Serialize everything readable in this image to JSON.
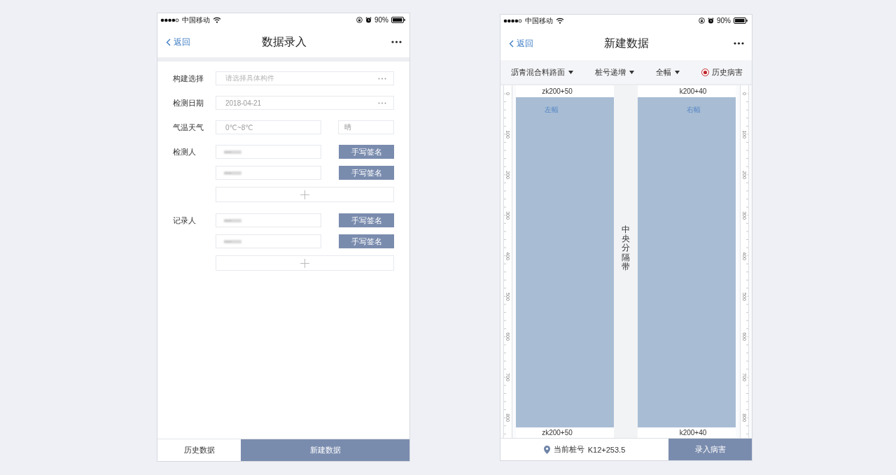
{
  "data_entry_screen": {
    "status_bar": {
      "carrier": "中国移动",
      "battery": "90%"
    },
    "nav_bar": {
      "back": "返回",
      "title": "数据录入"
    },
    "form": {
      "component": {
        "label": "构建选择",
        "placeholder": "请选择具体构件"
      },
      "inspection_date": {
        "label": "检测日期",
        "value": "2018-04-21"
      },
      "weather": {
        "label": "气温天气",
        "temperature": "0℃~8℃",
        "condition": "晴"
      },
      "people_groups": [
        {
          "label": "检测人",
          "entries": [
            {
              "redacted": true,
              "button": "手写签名"
            },
            {
              "redacted": true,
              "button": "手写签名"
            }
          ]
        },
        {
          "label": "记录人",
          "entries": [
            {
              "redacted": true,
              "button": "手写签名"
            },
            {
              "redacted": true,
              "button": "手写签名"
            }
          ]
        }
      ]
    },
    "bottom_actions": [
      {
        "label": "历史数据",
        "kind": "secondary"
      },
      {
        "label": "新建数据",
        "kind": "primary"
      }
    ]
  },
  "new_data_screen": {
    "status_bar": {
      "carrier": "中国移动",
      "battery": "90%"
    },
    "nav_bar": {
      "back": "返回",
      "title": "新建数据"
    },
    "dropdowns": [
      {
        "label": "沥青混合料路面"
      },
      {
        "label": "桩号递增"
      },
      {
        "label": "全幅"
      }
    ],
    "history_toggle": {
      "label": "历史病害",
      "on": true
    },
    "road_canvas": {
      "left_ruler": [
        "0",
        "100",
        "200",
        "300",
        "400",
        "500",
        "600",
        "700",
        "800"
      ],
      "lanes": [
        {
          "label": "左幅",
          "top_stake": "zk200+50",
          "bottom_stake": "zk200+50"
        },
        {
          "label": "右幅",
          "top_stake": "k200+40",
          "bottom_stake": "k200+40"
        }
      ],
      "median": "中央分隔带",
      "right_ruler": [
        "0",
        "100",
        "200",
        "300",
        "400",
        "500",
        "600",
        "700",
        "800"
      ]
    },
    "footer": {
      "stake_label": "当前桩号",
      "stake_value": "K12+253.5",
      "button": "录入病害"
    }
  }
}
